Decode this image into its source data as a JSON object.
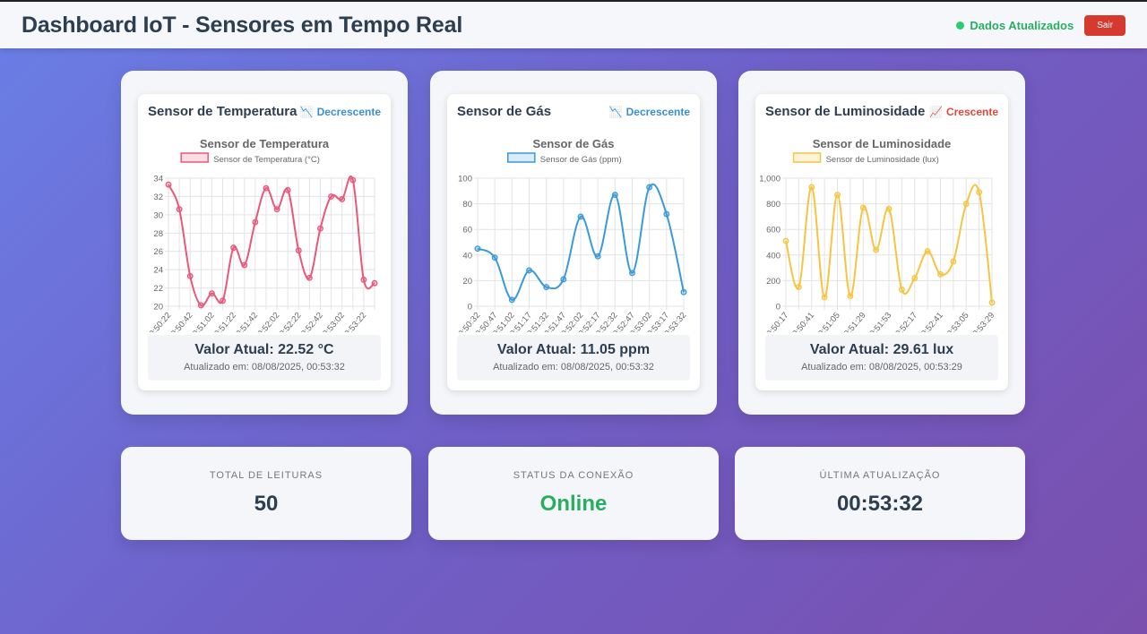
{
  "header": {
    "title": "Dashboard IoT - Sensores em Tempo Real",
    "status_text": "Dados Atualizados",
    "logout_label": "Sair"
  },
  "sensors": [
    {
      "title": "Sensor de Temperatura",
      "trend": {
        "icon": "chart-decreasing-icon",
        "glyph": "📉",
        "label": "Decrescente",
        "direction": "down"
      },
      "value_text": "Valor Atual: 22.52 °C",
      "updated_text": "Atualizado em: 08/08/2025, 00:53:32"
    },
    {
      "title": "Sensor de Gás",
      "trend": {
        "icon": "chart-decreasing-icon",
        "glyph": "📉",
        "label": "Decrescente",
        "direction": "down"
      },
      "value_text": "Valor Atual: 11.05 ppm",
      "updated_text": "Atualizado em: 08/08/2025, 00:53:32"
    },
    {
      "title": "Sensor de Luminosidade",
      "trend": {
        "icon": "chart-increasing-icon",
        "glyph": "📈",
        "label": "Crescente",
        "direction": "up"
      },
      "value_text": "Valor Atual: 29.61 lux",
      "updated_text": "Atualizado em: 08/08/2025, 00:53:29"
    }
  ],
  "stats": {
    "total": {
      "label": "TOTAL DE LEITURAS",
      "value": "50"
    },
    "connection": {
      "label": "STATUS DA CONEXÃO",
      "value": "Online"
    },
    "last_update": {
      "label": "ÚLTIMA ATUALIZAÇÃO",
      "value": "00:53:32"
    }
  },
  "colors": {
    "temperature": "#e8587a",
    "gas": "#3a9ad9",
    "light": "#f5c542",
    "online": "#27ae60",
    "logout": "#d63a2f"
  },
  "chart_data": [
    {
      "type": "line",
      "title": "Sensor de Temperatura",
      "series": [
        {
          "name": "Sensor de Temperatura (°C)",
          "color": "#e8587a",
          "values": [
            33.3,
            30.6,
            23.3,
            20.1,
            21.4,
            20.6,
            26.4,
            24.5,
            29.2,
            32.9,
            30.6,
            32.7,
            26.1,
            23.1,
            28.5,
            32.0,
            31.7,
            33.8,
            22.9,
            22.52
          ]
        }
      ],
      "x": [
        "00:50:22",
        "00:50:32",
        "00:50:42",
        "00:50:52",
        "00:51:02",
        "00:51:12",
        "00:51:22",
        "00:51:32",
        "00:51:42",
        "00:51:52",
        "00:52:02",
        "00:52:12",
        "00:52:22",
        "00:52:32",
        "00:52:42",
        "00:52:52",
        "00:53:02",
        "00:53:12",
        "00:53:22",
        "00:53:32"
      ],
      "xticks": [
        "00:50:22",
        "00:50:42",
        "00:51:02",
        "00:51:22",
        "00:51:42",
        "00:52:02",
        "00:52:22",
        "00:52:42",
        "00:53:02",
        "00:53:22"
      ],
      "ylim": [
        20,
        34
      ],
      "yticks": [
        "20",
        "22",
        "24",
        "26",
        "28",
        "30",
        "32",
        "34"
      ],
      "yvalues": [
        20,
        22,
        24,
        26,
        28,
        30,
        32,
        34
      ],
      "grid": true,
      "legend": "top"
    },
    {
      "type": "line",
      "title": "Sensor de Gás",
      "series": [
        {
          "name": "Sensor de Gás (ppm)",
          "color": "#3a9ad9",
          "values": [
            45,
            38,
            5,
            28,
            15,
            21,
            70,
            39,
            87,
            26,
            93,
            72,
            11.05
          ]
        }
      ],
      "x": [
        "00:50:32",
        "00:50:47",
        "00:51:02",
        "00:51:17",
        "00:51:32",
        "00:51:47",
        "00:52:02",
        "00:52:17",
        "00:52:32",
        "00:52:47",
        "00:53:02",
        "00:53:17",
        "00:53:32"
      ],
      "xticks": [
        "00:50:32",
        "00:50:47",
        "00:51:02",
        "00:51:17",
        "00:51:32",
        "00:51:47",
        "00:52:02",
        "00:52:17",
        "00:52:32",
        "00:52:47",
        "00:53:02",
        "00:53:17",
        "00:53:32"
      ],
      "ylim": [
        0,
        100
      ],
      "yticks": [
        "0",
        "20",
        "40",
        "60",
        "80",
        "100"
      ],
      "yvalues": [
        0,
        20,
        40,
        60,
        80,
        100
      ],
      "grid": true,
      "legend": "top"
    },
    {
      "type": "line",
      "title": "Sensor de Luminosidade",
      "series": [
        {
          "name": "Sensor de Luminosidade (lux)",
          "color": "#f5c542",
          "values": [
            510,
            150,
            930,
            70,
            870,
            80,
            770,
            440,
            760,
            130,
            220,
            430,
            250,
            350,
            800,
            890,
            29.61
          ]
        }
      ],
      "x": [
        "00:50:17",
        "00:50:29",
        "00:50:41",
        "00:50:53",
        "00:51:05",
        "00:51:17",
        "00:51:29",
        "00:51:41",
        "00:51:53",
        "00:52:05",
        "00:52:17",
        "00:52:29",
        "00:52:41",
        "00:52:53",
        "00:53:05",
        "00:53:17",
        "00:53:29"
      ],
      "xticks": [
        "00:50:17",
        "00:50:41",
        "00:51:05",
        "00:51:29",
        "00:51:53",
        "00:52:17",
        "00:52:41",
        "00:53:05",
        "00:53:29"
      ],
      "ylim": [
        0,
        1000
      ],
      "yticks": [
        "0",
        "200",
        "400",
        "600",
        "800",
        "1,000"
      ],
      "yvalues": [
        0,
        200,
        400,
        600,
        800,
        1000
      ],
      "grid": true,
      "legend": "top"
    }
  ]
}
